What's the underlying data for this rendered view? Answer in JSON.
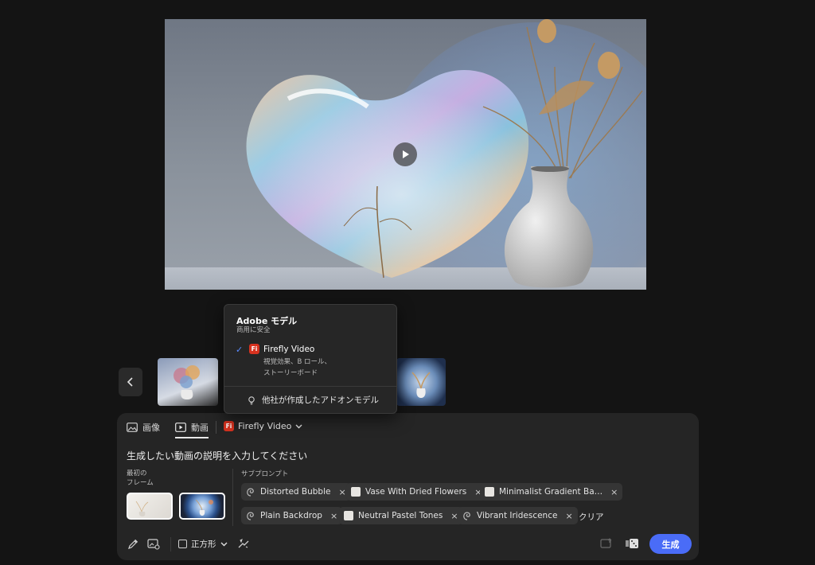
{
  "preview": {
    "play_icon": "play-icon"
  },
  "dropdown": {
    "title": "Adobe モデル",
    "subtitle": "商用に安全",
    "model_badge": "Fi",
    "model_name": "Firefly Video",
    "model_desc_line1": "視覚効果、B ロール、",
    "model_desc_line2": "ストーリーボード",
    "addon_label": "他社が作成したアドオンモデル"
  },
  "tabs": {
    "image": "画像",
    "video": "動画"
  },
  "model_select": {
    "badge": "Fi",
    "label": "Firefly Video"
  },
  "prompt": {
    "placeholder": "生成したい動画の説明を入力してください"
  },
  "first_frame": {
    "label_line1": "最初の",
    "label_line2": "フレーム"
  },
  "subprompts": {
    "label": "サブプロンプト",
    "chips": [
      {
        "label": "Distorted Bubble",
        "icon": "spiral-icon"
      },
      {
        "label": "Vase With Dried Flowers",
        "icon": "swatch-icon"
      },
      {
        "label": "Minimalist Gradient Ba…",
        "icon": "swatch-icon"
      },
      {
        "label": "Plain Backdrop",
        "icon": "spiral-icon"
      },
      {
        "label": "Neutral Pastel Tones",
        "icon": "swatch-icon"
      },
      {
        "label": "Vibrant Iridescence",
        "icon": "spiral-icon"
      }
    ],
    "close_glyph": "×",
    "clear_label": "クリア"
  },
  "toolbar": {
    "aspect_label": "正方形",
    "generate_label": "生成"
  },
  "colors": {
    "accent": "#4a6cf7",
    "firefly_badge": "#d7321f",
    "panel": "#252525",
    "background": "#141414"
  }
}
